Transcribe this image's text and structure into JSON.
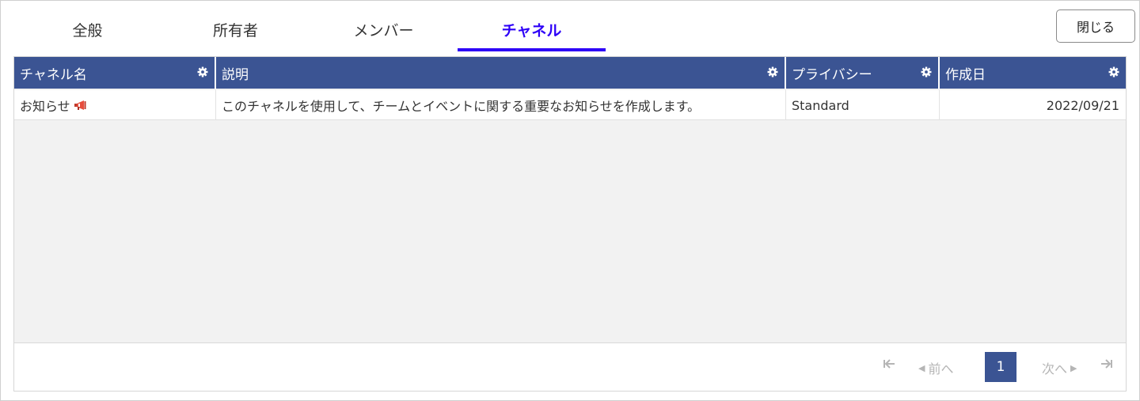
{
  "tabs": [
    {
      "label": "全般",
      "active": false
    },
    {
      "label": "所有者",
      "active": false
    },
    {
      "label": "メンバー",
      "active": false
    },
    {
      "label": "チャネル",
      "active": true
    }
  ],
  "close_label": "閉じる",
  "grid": {
    "columns": [
      "チャネル名",
      "説明",
      "プライバシー",
      "作成日"
    ],
    "rows": [
      {
        "name": "お知らせ",
        "name_icon": "megaphone-icon",
        "description": "このチャネルを使用して、チームとイベントに関する重要なお知らせを作成します。",
        "privacy": "Standard",
        "created": "2022/09/21"
      }
    ]
  },
  "pager": {
    "prev_label": "前へ",
    "next_label": "次へ",
    "current_page": "1"
  },
  "colors": {
    "header_bg": "#3b5493",
    "active_tab": "#2d00f7",
    "empty_area": "#f2f2f2"
  }
}
